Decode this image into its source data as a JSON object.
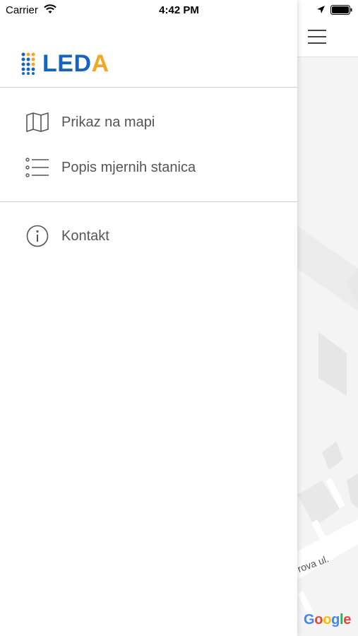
{
  "status_bar": {
    "carrier": "Carrier",
    "time": "4:42 PM"
  },
  "logo": {
    "text_main": "LED",
    "text_accent": "A",
    "colors": {
      "primary": "#1565c0",
      "accent": "#f5a623"
    }
  },
  "menu": {
    "items": [
      {
        "label": "Prikaz na mapi",
        "icon": "map-icon"
      },
      {
        "label": "Popis mjernih stanica",
        "icon": "list-icon"
      },
      {
        "label": "Kontakt",
        "icon": "info-icon"
      }
    ]
  },
  "map": {
    "street_label": "rova ul.",
    "attribution": [
      "G",
      "o",
      "o",
      "g",
      "l",
      "e"
    ]
  }
}
